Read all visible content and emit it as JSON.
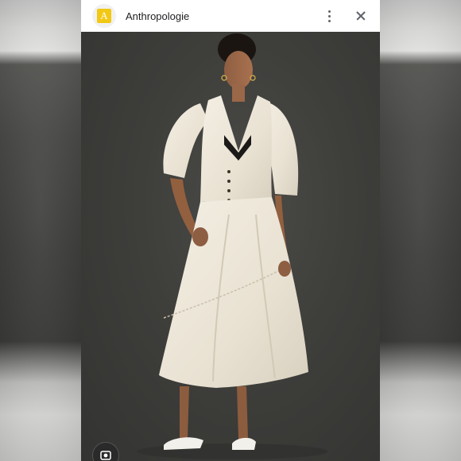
{
  "header": {
    "app_icon_letter": "A",
    "site_title": "Anthropologie"
  },
  "icons": {
    "menu": "more-vertical-icon",
    "close": "close-icon",
    "lens": "lens-search-icon"
  },
  "colors": {
    "app_icon_bg": "#f2c814",
    "photo_backdrop": "#3c3c3a",
    "dress": "#efe9dc"
  }
}
